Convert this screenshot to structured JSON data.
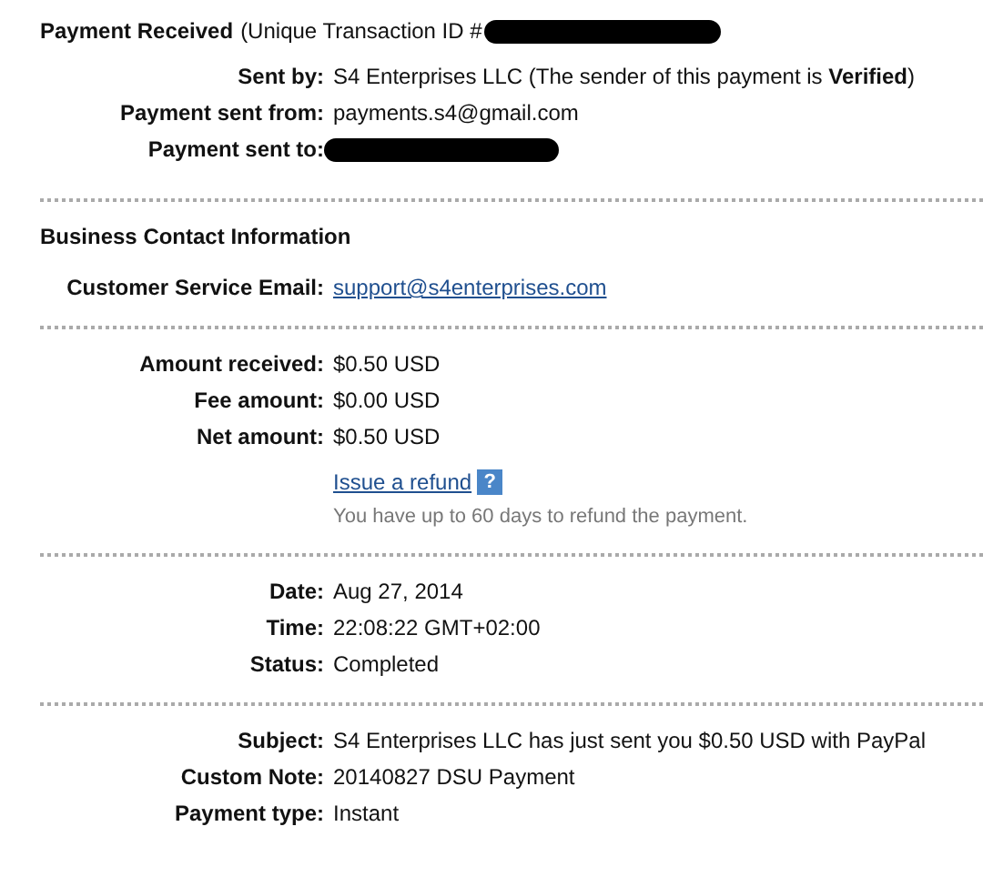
{
  "header": {
    "title": "Payment Received",
    "subtitle": "(Unique Transaction ID #",
    "id_redacted": true
  },
  "sections": [
    {
      "rows": [
        {
          "kind": "text",
          "label": "Sent by:",
          "value": "S4 Enterprises LLC (The sender of this payment is **Verified**)"
        },
        {
          "kind": "text",
          "label": "Payment sent from:",
          "value": "payments.s4@gmail.com"
        },
        {
          "kind": "redacted",
          "label": "Payment sent to:"
        }
      ]
    },
    {
      "heading": "Business Contact Information",
      "rows": [
        {
          "kind": "link",
          "label": "Customer Service Email:",
          "value": "support@s4enterprises.com"
        }
      ]
    },
    {
      "rows": [
        {
          "kind": "text",
          "label": "Amount received:",
          "value": "$0.50 USD"
        },
        {
          "kind": "text",
          "label": "Fee amount:",
          "value": "$0.00 USD"
        },
        {
          "kind": "text",
          "label": "Net amount:",
          "value": "$0.50 USD"
        },
        {
          "kind": "refund",
          "link": "Issue a refund",
          "help": "?",
          "note": "You have up to 60 days to refund the payment."
        }
      ]
    },
    {
      "rows": [
        {
          "kind": "text",
          "label": "Date:",
          "value": "Aug 27, 2014"
        },
        {
          "kind": "text",
          "label": "Time:",
          "value": "22:08:22 GMT+02:00"
        },
        {
          "kind": "text",
          "label": "Status:",
          "value": "Completed"
        }
      ]
    },
    {
      "rows": [
        {
          "kind": "text",
          "label": "Subject:",
          "value": "S4 Enterprises LLC has just sent you $0.50 USD with PayPal"
        },
        {
          "kind": "text",
          "label": "Custom Note:",
          "value": "20140827 DSU Payment"
        },
        {
          "kind": "text",
          "label": "Payment type:",
          "value": "Instant"
        }
      ]
    }
  ]
}
